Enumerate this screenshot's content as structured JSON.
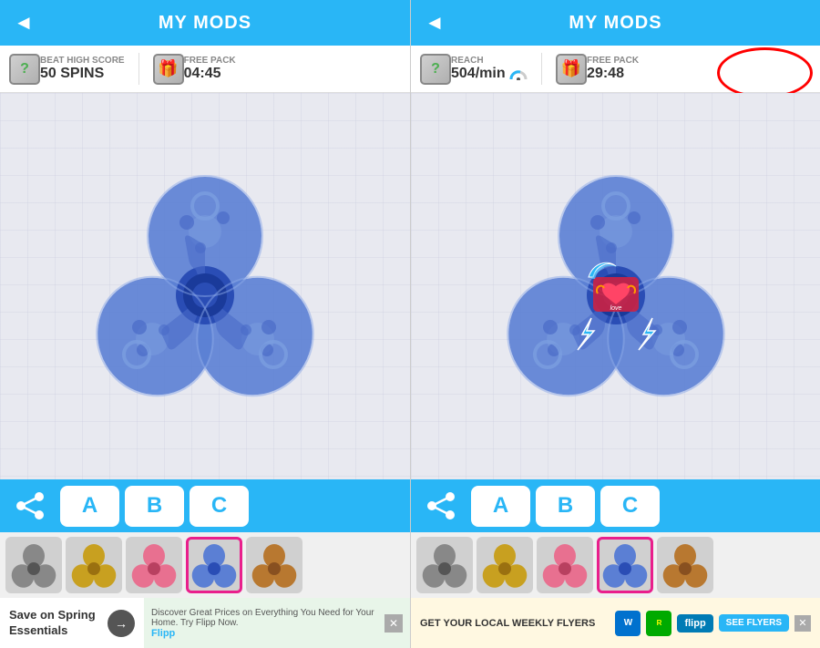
{
  "screens": [
    {
      "id": "left",
      "header": {
        "title": "MY MODS",
        "back_label": "◄"
      },
      "stats": [
        {
          "icon": "question",
          "label": "BEAT HIGH SCORE",
          "value": "50 SPINS"
        },
        {
          "icon": "gift",
          "label": "FREE PACK",
          "value": "04:45"
        }
      ],
      "tabs": [
        "A",
        "B",
        "C"
      ],
      "selected_thumb": 3,
      "spinner_color": "blue_plain",
      "ad": {
        "left_text": "Save on Spring Essentials",
        "right_text": "Discover Great Prices on Everything You Need for Your Home. Try Flipp Now.",
        "brand": "Flipp"
      }
    },
    {
      "id": "right",
      "header": {
        "title": "MY MODS",
        "back_label": "◄"
      },
      "stats": [
        {
          "icon": "question",
          "label": "REACH",
          "value": "504/min"
        },
        {
          "icon": "gift",
          "label": "FREE PACK",
          "value": "29:48"
        }
      ],
      "tabs": [
        "A",
        "B",
        "C"
      ],
      "selected_thumb": 3,
      "spinner_color": "blue_stickers",
      "has_annotation": true,
      "ad": {
        "text": "GET YOUR LOCAL WEEKLY FLYERS",
        "brand": "flipp",
        "cta": "SEE FLYERS"
      }
    }
  ],
  "thumb_colors": [
    "gray",
    "gold",
    "pink",
    "blue",
    "dark_gold"
  ],
  "icons": {
    "back": "◄",
    "share": "share",
    "gift": "🎁",
    "question": "?"
  }
}
